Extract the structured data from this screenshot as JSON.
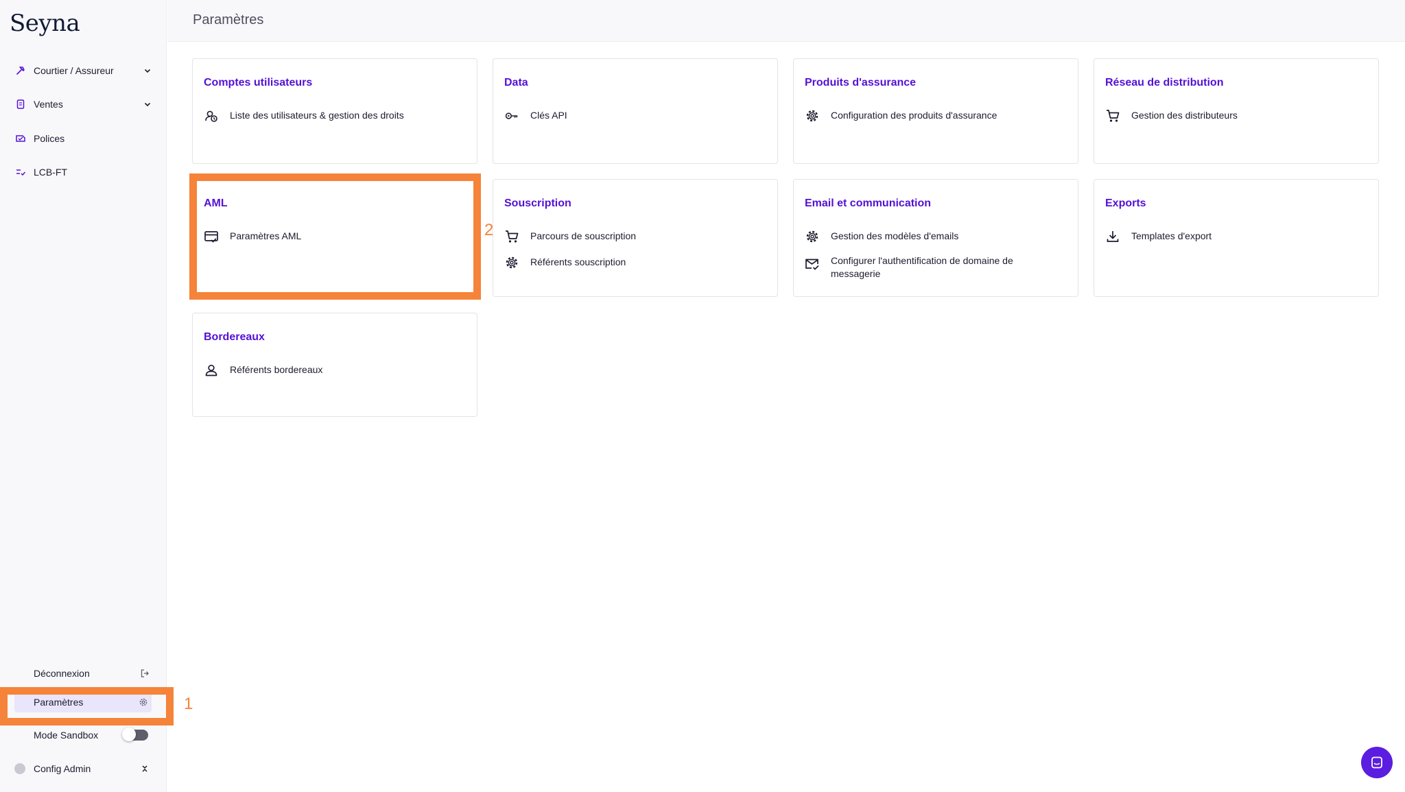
{
  "brand": {
    "name": "Seyna"
  },
  "colors": {
    "accent": "#5410d6",
    "highlight": "#f58339",
    "chat": "#5b1de0"
  },
  "sidebar": {
    "items": [
      {
        "label": "Courtier / Assureur",
        "icon": "hammer-icon",
        "has_chevron": true
      },
      {
        "label": "Ventes",
        "icon": "document-icon",
        "has_chevron": true
      },
      {
        "label": "Polices",
        "icon": "policy-icon",
        "has_chevron": false
      },
      {
        "label": "LCB-FT",
        "icon": "checklist-icon",
        "has_chevron": false
      }
    ],
    "bottom": {
      "logout_label": "Déconnexion",
      "settings_label": "Paramètres",
      "sandbox_label": "Mode Sandbox",
      "admin_label": "Config Admin"
    }
  },
  "annotations": {
    "marker_1": "1",
    "marker_2": "2"
  },
  "header": {
    "title": "Paramètres"
  },
  "cards": [
    {
      "title": "Comptes utilisateurs",
      "links": [
        {
          "label": "Liste des utilisateurs & gestion des droits",
          "icon": "user-shield-icon"
        }
      ]
    },
    {
      "title": "Data",
      "links": [
        {
          "label": "Clés API",
          "icon": "key-icon"
        }
      ]
    },
    {
      "title": "Produits d'assurance",
      "links": [
        {
          "label": "Configuration des produits d'assurance",
          "icon": "gear-icon"
        }
      ]
    },
    {
      "title": "Réseau de distribution",
      "links": [
        {
          "label": "Gestion des distributeurs",
          "icon": "cart-icon"
        }
      ]
    },
    {
      "title": "AML",
      "links": [
        {
          "label": "Paramètres AML",
          "icon": "card-check-icon"
        }
      ]
    },
    {
      "title": "Souscription",
      "links": [
        {
          "label": "Parcours de souscription",
          "icon": "cart-icon"
        },
        {
          "label": "Référents souscription",
          "icon": "gear-icon"
        }
      ]
    },
    {
      "title": "Email et communication",
      "links": [
        {
          "label": "Gestion des modèles d'emails",
          "icon": "gear-icon"
        },
        {
          "label": "Configurer l'authentification de domaine de messagerie",
          "icon": "mail-check-icon"
        }
      ]
    },
    {
      "title": "Exports",
      "links": [
        {
          "label": "Templates d'export",
          "icon": "download-icon"
        }
      ]
    },
    {
      "title": "Bordereaux",
      "links": [
        {
          "label": "Référents bordereaux",
          "icon": "user-icon"
        }
      ]
    }
  ]
}
